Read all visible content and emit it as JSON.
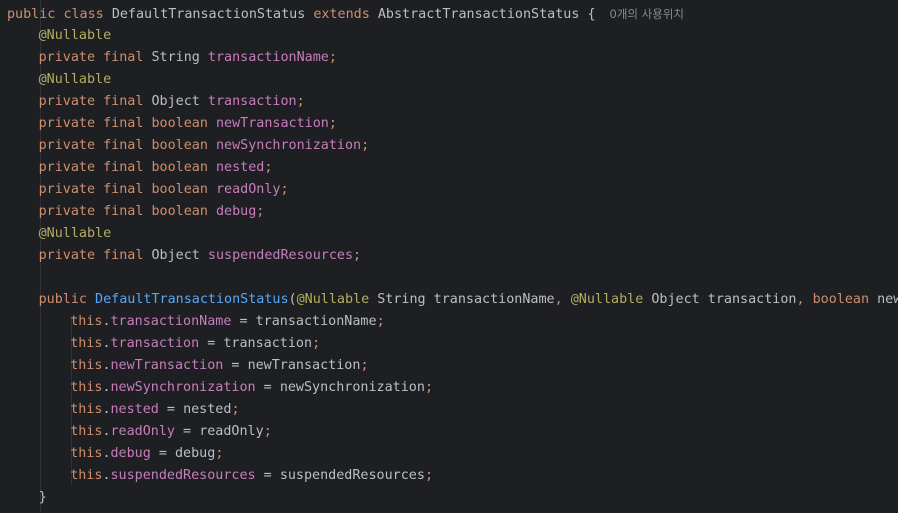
{
  "editor": {
    "theme": {
      "background": "#1e1f22",
      "keyword": "#cf8e6d",
      "annotation": "#b3ae60",
      "field": "#c77dbb",
      "method": "#56a8f5",
      "text": "#bcbec4",
      "hint": "#868a91"
    },
    "usage_hint": "0개의 사용위치",
    "lines": [
      {
        "indent": 0,
        "tokens": [
          {
            "t": "public",
            "k": "kw"
          },
          {
            "t": " ",
            "k": "txt"
          },
          {
            "t": "class",
            "k": "kw"
          },
          {
            "t": " ",
            "k": "txt"
          },
          {
            "t": "DefaultTransactionStatus",
            "k": "ty"
          },
          {
            "t": " ",
            "k": "txt"
          },
          {
            "t": "extends",
            "k": "kw"
          },
          {
            "t": " ",
            "k": "txt"
          },
          {
            "t": "AbstractTransactionStatus",
            "k": "ty"
          },
          {
            "t": " {",
            "k": "pun"
          }
        ],
        "hint": true
      },
      {
        "indent": 1,
        "tokens": [
          {
            "t": "@Nullable",
            "k": "ann"
          }
        ]
      },
      {
        "indent": 1,
        "tokens": [
          {
            "t": "private",
            "k": "kw"
          },
          {
            "t": " ",
            "k": "txt"
          },
          {
            "t": "final",
            "k": "kw"
          },
          {
            "t": " ",
            "k": "txt"
          },
          {
            "t": "String",
            "k": "ty"
          },
          {
            "t": " ",
            "k": "txt"
          },
          {
            "t": "transactionName",
            "k": "fld"
          },
          {
            "t": ";",
            "k": "semi"
          }
        ]
      },
      {
        "indent": 1,
        "tokens": [
          {
            "t": "@Nullable",
            "k": "ann"
          }
        ]
      },
      {
        "indent": 1,
        "tokens": [
          {
            "t": "private",
            "k": "kw"
          },
          {
            "t": " ",
            "k": "txt"
          },
          {
            "t": "final",
            "k": "kw"
          },
          {
            "t": " ",
            "k": "txt"
          },
          {
            "t": "Object",
            "k": "ty"
          },
          {
            "t": " ",
            "k": "txt"
          },
          {
            "t": "transaction",
            "k": "fld"
          },
          {
            "t": ";",
            "k": "semi"
          }
        ]
      },
      {
        "indent": 1,
        "tokens": [
          {
            "t": "private",
            "k": "kw"
          },
          {
            "t": " ",
            "k": "txt"
          },
          {
            "t": "final",
            "k": "kw"
          },
          {
            "t": " ",
            "k": "txt"
          },
          {
            "t": "boolean",
            "k": "kw"
          },
          {
            "t": " ",
            "k": "txt"
          },
          {
            "t": "newTransaction",
            "k": "fld"
          },
          {
            "t": ";",
            "k": "semi"
          }
        ]
      },
      {
        "indent": 1,
        "tokens": [
          {
            "t": "private",
            "k": "kw"
          },
          {
            "t": " ",
            "k": "txt"
          },
          {
            "t": "final",
            "k": "kw"
          },
          {
            "t": " ",
            "k": "txt"
          },
          {
            "t": "boolean",
            "k": "kw"
          },
          {
            "t": " ",
            "k": "txt"
          },
          {
            "t": "newSynchronization",
            "k": "fld"
          },
          {
            "t": ";",
            "k": "semi"
          }
        ]
      },
      {
        "indent": 1,
        "tokens": [
          {
            "t": "private",
            "k": "kw"
          },
          {
            "t": " ",
            "k": "txt"
          },
          {
            "t": "final",
            "k": "kw"
          },
          {
            "t": " ",
            "k": "txt"
          },
          {
            "t": "boolean",
            "k": "kw"
          },
          {
            "t": " ",
            "k": "txt"
          },
          {
            "t": "nested",
            "k": "fld"
          },
          {
            "t": ";",
            "k": "semi"
          }
        ]
      },
      {
        "indent": 1,
        "tokens": [
          {
            "t": "private",
            "k": "kw"
          },
          {
            "t": " ",
            "k": "txt"
          },
          {
            "t": "final",
            "k": "kw"
          },
          {
            "t": " ",
            "k": "txt"
          },
          {
            "t": "boolean",
            "k": "kw"
          },
          {
            "t": " ",
            "k": "txt"
          },
          {
            "t": "readOnly",
            "k": "fld"
          },
          {
            "t": ";",
            "k": "semi"
          }
        ]
      },
      {
        "indent": 1,
        "tokens": [
          {
            "t": "private",
            "k": "kw"
          },
          {
            "t": " ",
            "k": "txt"
          },
          {
            "t": "final",
            "k": "kw"
          },
          {
            "t": " ",
            "k": "txt"
          },
          {
            "t": "boolean",
            "k": "kw"
          },
          {
            "t": " ",
            "k": "txt"
          },
          {
            "t": "debug",
            "k": "fld"
          },
          {
            "t": ";",
            "k": "semi"
          }
        ]
      },
      {
        "indent": 1,
        "tokens": [
          {
            "t": "@Nullable",
            "k": "ann"
          }
        ]
      },
      {
        "indent": 1,
        "tokens": [
          {
            "t": "private",
            "k": "kw"
          },
          {
            "t": " ",
            "k": "txt"
          },
          {
            "t": "final",
            "k": "kw"
          },
          {
            "t": " ",
            "k": "txt"
          },
          {
            "t": "Object",
            "k": "ty"
          },
          {
            "t": " ",
            "k": "txt"
          },
          {
            "t": "suspendedResources",
            "k": "fld"
          },
          {
            "t": ";",
            "k": "semi"
          }
        ]
      },
      {
        "indent": 0,
        "tokens": []
      },
      {
        "indent": 1,
        "tokens": [
          {
            "t": "public",
            "k": "kw"
          },
          {
            "t": " ",
            "k": "txt"
          },
          {
            "t": "DefaultTransactionStatus",
            "k": "fn"
          },
          {
            "t": "(",
            "k": "pun"
          },
          {
            "t": "@Nullable",
            "k": "ann"
          },
          {
            "t": " ",
            "k": "txt"
          },
          {
            "t": "String",
            "k": "ty"
          },
          {
            "t": " ",
            "k": "txt"
          },
          {
            "t": "transactionName",
            "k": "txt"
          },
          {
            "t": ",",
            "k": "semi"
          },
          {
            "t": " ",
            "k": "txt"
          },
          {
            "t": "@Nullable",
            "k": "ann"
          },
          {
            "t": " ",
            "k": "txt"
          },
          {
            "t": "Object",
            "k": "ty"
          },
          {
            "t": " ",
            "k": "txt"
          },
          {
            "t": "transaction",
            "k": "txt"
          },
          {
            "t": ",",
            "k": "semi"
          },
          {
            "t": " ",
            "k": "txt"
          },
          {
            "t": "boolean",
            "k": "kw"
          },
          {
            "t": " ",
            "k": "txt"
          },
          {
            "t": "newTran",
            "k": "txt"
          }
        ]
      },
      {
        "indent": 2,
        "tokens": [
          {
            "t": "this",
            "k": "kw"
          },
          {
            "t": ".",
            "k": "pun"
          },
          {
            "t": "transactionName",
            "k": "fld"
          },
          {
            "t": " = ",
            "k": "pun"
          },
          {
            "t": "transactionName",
            "k": "txt"
          },
          {
            "t": ";",
            "k": "semi"
          }
        ]
      },
      {
        "indent": 2,
        "tokens": [
          {
            "t": "this",
            "k": "kw"
          },
          {
            "t": ".",
            "k": "pun"
          },
          {
            "t": "transaction",
            "k": "fld"
          },
          {
            "t": " = ",
            "k": "pun"
          },
          {
            "t": "transaction",
            "k": "txt"
          },
          {
            "t": ";",
            "k": "semi"
          }
        ]
      },
      {
        "indent": 2,
        "tokens": [
          {
            "t": "this",
            "k": "kw"
          },
          {
            "t": ".",
            "k": "pun"
          },
          {
            "t": "newTransaction",
            "k": "fld"
          },
          {
            "t": " = ",
            "k": "pun"
          },
          {
            "t": "newTransaction",
            "k": "txt"
          },
          {
            "t": ";",
            "k": "semi"
          }
        ]
      },
      {
        "indent": 2,
        "tokens": [
          {
            "t": "this",
            "k": "kw"
          },
          {
            "t": ".",
            "k": "pun"
          },
          {
            "t": "newSynchronization",
            "k": "fld"
          },
          {
            "t": " = ",
            "k": "pun"
          },
          {
            "t": "newSynchronization",
            "k": "txt"
          },
          {
            "t": ";",
            "k": "semi"
          }
        ]
      },
      {
        "indent": 2,
        "tokens": [
          {
            "t": "this",
            "k": "kw"
          },
          {
            "t": ".",
            "k": "pun"
          },
          {
            "t": "nested",
            "k": "fld"
          },
          {
            "t": " = ",
            "k": "pun"
          },
          {
            "t": "nested",
            "k": "txt"
          },
          {
            "t": ";",
            "k": "semi"
          }
        ]
      },
      {
        "indent": 2,
        "tokens": [
          {
            "t": "this",
            "k": "kw"
          },
          {
            "t": ".",
            "k": "pun"
          },
          {
            "t": "readOnly",
            "k": "fld"
          },
          {
            "t": " = ",
            "k": "pun"
          },
          {
            "t": "readOnly",
            "k": "txt"
          },
          {
            "t": ";",
            "k": "semi"
          }
        ]
      },
      {
        "indent": 2,
        "tokens": [
          {
            "t": "this",
            "k": "kw"
          },
          {
            "t": ".",
            "k": "pun"
          },
          {
            "t": "debug",
            "k": "fld"
          },
          {
            "t": " = ",
            "k": "pun"
          },
          {
            "t": "debug",
            "k": "txt"
          },
          {
            "t": ";",
            "k": "semi"
          }
        ]
      },
      {
        "indent": 2,
        "tokens": [
          {
            "t": "this",
            "k": "kw"
          },
          {
            "t": ".",
            "k": "pun"
          },
          {
            "t": "suspendedResources",
            "k": "fld"
          },
          {
            "t": " = ",
            "k": "pun"
          },
          {
            "t": "suspendedResources",
            "k": "txt"
          },
          {
            "t": ";",
            "k": "semi"
          }
        ]
      },
      {
        "indent": 1,
        "tokens": [
          {
            "t": "}",
            "k": "pun"
          }
        ]
      }
    ]
  }
}
